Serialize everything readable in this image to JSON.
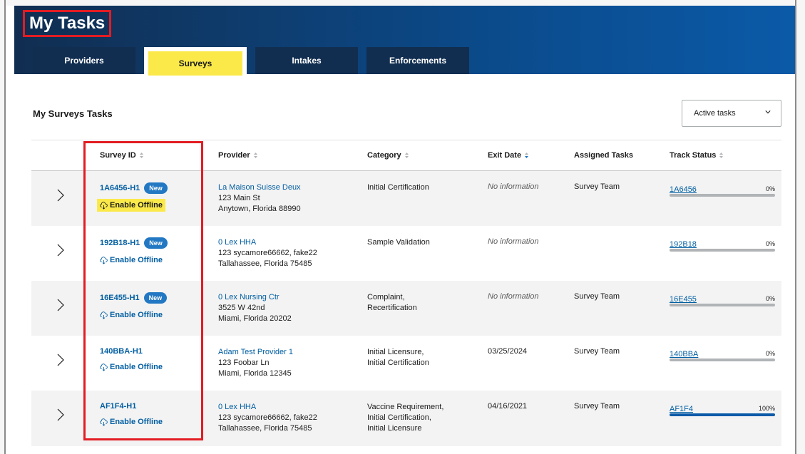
{
  "header": {
    "title": "My Tasks",
    "tabs": [
      {
        "label": "Providers",
        "active": false
      },
      {
        "label": "Surveys",
        "active": true
      },
      {
        "label": "Intakes",
        "active": false
      },
      {
        "label": "Enforcements",
        "active": false
      }
    ]
  },
  "section": {
    "title": "My Surveys Tasks",
    "filter": {
      "selected": "Active tasks",
      "icon": "chevron-down-icon"
    }
  },
  "table": {
    "columns": [
      {
        "label": "Survey ID",
        "sortable": true
      },
      {
        "label": "Provider",
        "sortable": true
      },
      {
        "label": "Category",
        "sortable": true
      },
      {
        "label": "Exit Date",
        "sortable": true,
        "sorted": "desc"
      },
      {
        "label": "Assigned Tasks",
        "sortable": false
      },
      {
        "label": "Track Status",
        "sortable": true
      }
    ],
    "rows": [
      {
        "survey_id": "1A6456-H1",
        "badge": "New",
        "offline": "Enable Offline",
        "offline_highlight": true,
        "provider_name": "La Maison Suisse Deux",
        "provider_addr1": "123 Main St",
        "provider_addr2": "Anytown, Florida 88990",
        "category": "Initial Certification",
        "exit_date": "No information",
        "exit_noinfo": true,
        "assigned": "Survey Team",
        "track_link": "1A6456",
        "track_pct": "0%",
        "progress": 0
      },
      {
        "survey_id": "192B18-H1",
        "badge": "New",
        "offline": "Enable Offline",
        "offline_highlight": false,
        "provider_name": "0 Lex HHA",
        "provider_addr1": "123 sycamore66662, fake22",
        "provider_addr2": "Tallahassee, Florida 75485",
        "category": "Sample Validation",
        "exit_date": "No information",
        "exit_noinfo": true,
        "assigned": "",
        "track_link": "192B18",
        "track_pct": "0%",
        "progress": 0
      },
      {
        "survey_id": "16E455-H1",
        "badge": "New",
        "offline": "Enable Offline",
        "offline_highlight": false,
        "provider_name": "0 Lex Nursing Ctr",
        "provider_addr1": "3525 W 42nd",
        "provider_addr2": "Miami, Florida 20202",
        "category": "Complaint,\nRecertification",
        "exit_date": "No information",
        "exit_noinfo": true,
        "assigned": "Survey Team",
        "track_link": "16E455",
        "track_pct": "0%",
        "progress": 0
      },
      {
        "survey_id": "140BBA-H1",
        "badge": "",
        "offline": "Enable Offline",
        "offline_highlight": false,
        "provider_name": "Adam Test Provider 1",
        "provider_addr1": "123 Foobar Ln",
        "provider_addr2": "Miami, Florida 12345",
        "category": "Initial Licensure,\nInitial Certification",
        "exit_date": "03/25/2024",
        "exit_noinfo": false,
        "assigned": "Survey Team",
        "track_link": "140BBA",
        "track_pct": "0%",
        "progress": 0
      },
      {
        "survey_id": "AF1F4-H1",
        "badge": "",
        "offline": "Enable Offline",
        "offline_highlight": false,
        "provider_name": "0 Lex HHA",
        "provider_addr1": "123 sycamore66662, fake22",
        "provider_addr2": "Tallahassee, Florida 75485",
        "category": "Vaccine Requirement,\nInitial Certification,\nInitial Licensure",
        "exit_date": "04/16/2021",
        "exit_noinfo": false,
        "assigned": "Survey Team",
        "track_link": "AF1F4",
        "track_pct": "100%",
        "progress": 1.0
      }
    ]
  },
  "colors": {
    "header_dark": "#112e51",
    "header_blue": "#0b5aa8",
    "link": "#005ea2",
    "badge": "#2378c3",
    "highlight": "#fbe94a",
    "annotation": "#e31c23"
  }
}
